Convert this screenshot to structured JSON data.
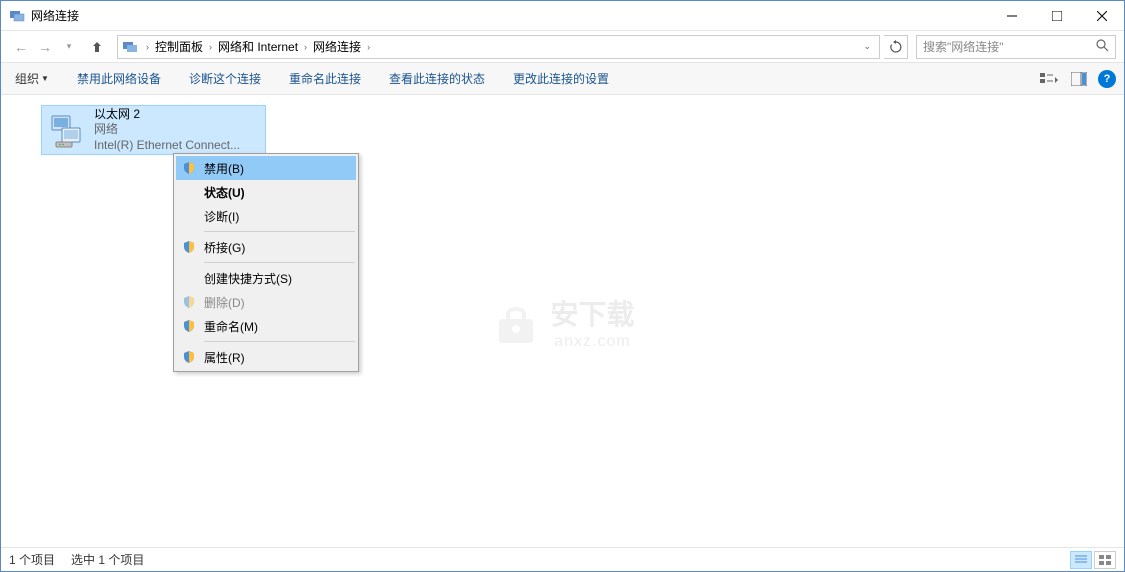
{
  "window": {
    "title": "网络连接"
  },
  "breadcrumb": {
    "items": [
      "控制面板",
      "网络和 Internet",
      "网络连接"
    ]
  },
  "search": {
    "placeholder": "搜索\"网络连接\""
  },
  "toolbar": {
    "organize": "组织",
    "disable": "禁用此网络设备",
    "diagnose": "诊断这个连接",
    "rename": "重命名此连接",
    "view_status": "查看此连接的状态",
    "change_settings": "更改此连接的设置"
  },
  "connection": {
    "name": "以太网 2",
    "status": "网络",
    "device": "Intel(R) Ethernet Connect..."
  },
  "context_menu": {
    "disable": "禁用(B)",
    "status": "状态(U)",
    "diagnose": "诊断(I)",
    "bridge": "桥接(G)",
    "shortcut": "创建快捷方式(S)",
    "delete": "删除(D)",
    "rename": "重命名(M)",
    "properties": "属性(R)"
  },
  "statusbar": {
    "count": "1 个项目",
    "selected": "选中 1 个项目"
  },
  "watermark": {
    "text": "安下载",
    "url": "anxz.com"
  }
}
